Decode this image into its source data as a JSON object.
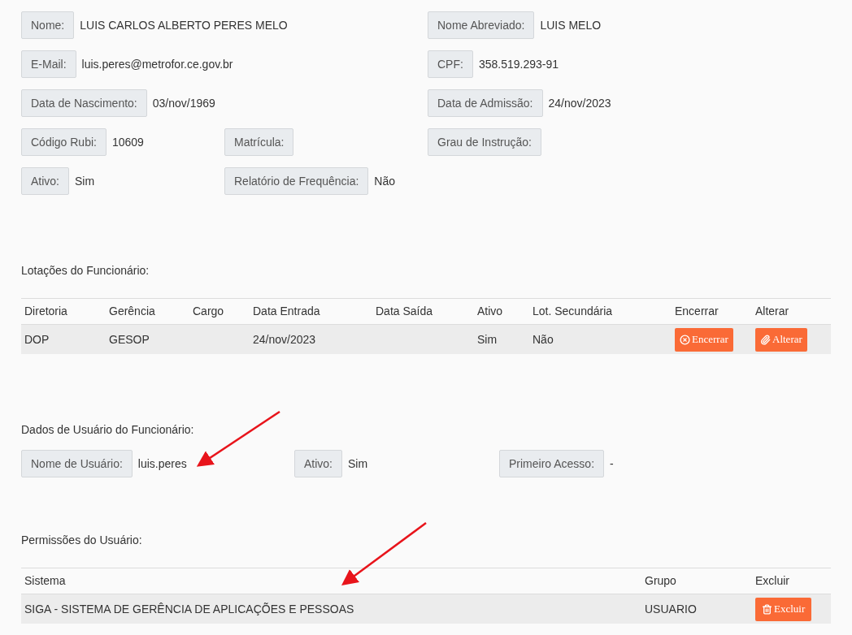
{
  "employee_fields": [
    [
      {
        "kind": "wide",
        "label": "Nome:",
        "value": "LUIS CARLOS ALBERTO PERES MELO"
      },
      {
        "kind": "normal",
        "label": "Nome Abreviado:",
        "value": "LUIS MELO"
      }
    ],
    [
      {
        "kind": "wide",
        "label": "E-Mail:",
        "value": "luis.peres@metrofor.ce.gov.br"
      },
      {
        "kind": "normal",
        "label": "CPF:",
        "value": "358.519.293-91"
      }
    ],
    [
      {
        "kind": "wide",
        "label": "Data de Nascimento:",
        "value": "03/nov/1969"
      },
      {
        "kind": "normal",
        "label": "Data de Admissão:",
        "value": "24/nov/2023"
      }
    ],
    [
      {
        "kind": "normal",
        "label": "Código Rubi:",
        "value": "10609"
      },
      {
        "kind": "normal",
        "label": "Matrícula:"
      },
      {
        "kind": "normal",
        "label": "Grau de Instrução:"
      }
    ],
    [
      {
        "kind": "normal",
        "label": "Ativo:",
        "value": "Sim"
      },
      {
        "kind": "normal",
        "label": "Relatório de Frequência:",
        "value": "Não"
      }
    ]
  ],
  "lotacoes": {
    "title": "Lotações do Funcionário:",
    "columns": [
      "Diretoria",
      "Gerência",
      "Cargo",
      "Data Entrada",
      "Data Saída",
      "Ativo",
      "Lot. Secundária",
      "Encerrar",
      "Alterar"
    ],
    "rows": [
      {
        "cells": [
          "DOP",
          "GESOP",
          "",
          "24/nov/2023",
          "",
          "Sim",
          "Não"
        ],
        "close_button": "Encerrar",
        "edit_button": "Alterar"
      }
    ]
  },
  "user_data": {
    "title": "Dados de Usuário do Funcionário:",
    "fields": [
      {
        "label": "Nome de Usuário:",
        "value": "luis.peres"
      },
      {
        "label": "Ativo:",
        "value": "Sim"
      },
      {
        "label": "Primeiro Acesso:",
        "value": "-"
      }
    ]
  },
  "permissions": {
    "title": "Permissões do Usuário:",
    "columns": [
      "Sistema",
      "Grupo",
      "Excluir"
    ],
    "rows": [
      {
        "system": "SIGA - SISTEMA DE GERÊNCIA DE APLICAÇÕES E PESSOAS",
        "group": "USUARIO",
        "delete_button": "Excluir"
      }
    ]
  }
}
